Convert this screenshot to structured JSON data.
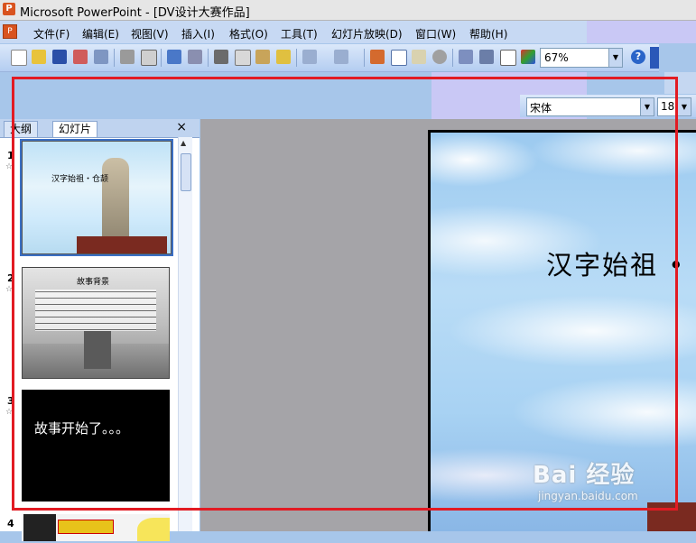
{
  "window": {
    "title": "Microsoft PowerPoint - [DV设计大赛作品]",
    "app_icon": "powerpoint-icon"
  },
  "menu": [
    "文件(F)",
    "编辑(E)",
    "视图(V)",
    "插入(I)",
    "格式(O)",
    "工具(T)",
    "幻灯片放映(D)",
    "窗口(W)",
    "帮助(H)"
  ],
  "toolbar": {
    "zoom": "67%"
  },
  "format_toolbar": {
    "font": "宋体",
    "size": "18"
  },
  "panel": {
    "tabs": [
      "大纲",
      "幻灯片"
    ],
    "active_tab": "幻灯片",
    "close": "×",
    "slides": [
      {
        "num": "1",
        "title": "汉字始祖・仓颉"
      },
      {
        "num": "2",
        "title": "故事背景"
      },
      {
        "num": "3",
        "text": "故事开始了。。。"
      },
      {
        "num": "4"
      }
    ]
  },
  "slide": {
    "title": "汉字始祖 •"
  },
  "watermark": {
    "brand": "Bai 经验",
    "url": "jingyan.baidu.com"
  },
  "colors": {
    "highlight_box": "#e21b23",
    "workarea": "#a5a4a8"
  }
}
